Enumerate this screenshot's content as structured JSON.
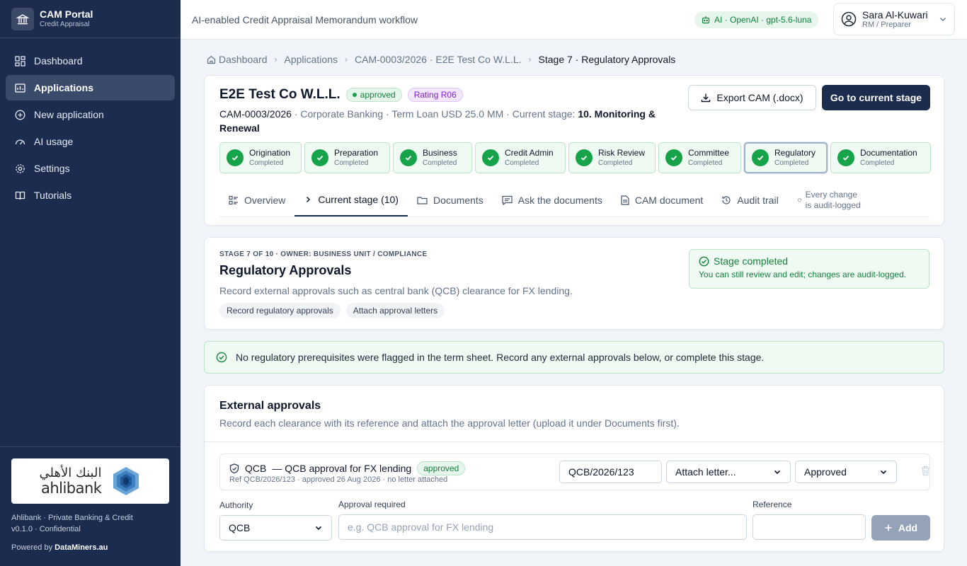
{
  "brand": {
    "title": "CAM Portal",
    "subtitle": "Credit Appraisal"
  },
  "sidebar": {
    "items": [
      {
        "label": "Dashboard",
        "icon": "dashboard-icon"
      },
      {
        "label": "Applications",
        "icon": "applications-icon",
        "active": true
      },
      {
        "label": "New application",
        "icon": "plus-circle-icon"
      },
      {
        "label": "AI usage",
        "icon": "gauge-icon"
      },
      {
        "label": "Settings",
        "icon": "gear-icon"
      },
      {
        "label": "Tutorials",
        "icon": "book-icon"
      }
    ],
    "bank_logo": {
      "arabic": "البنك الأهلي",
      "english": "ahlibank"
    },
    "footer_line1": "Ahlibank · Private Banking & Credit",
    "footer_line2": "v0.1.0 · Confidential",
    "powered_prefix": "Powered by",
    "powered_by": "DataMiners.au"
  },
  "header": {
    "title": "AI-enabled Credit Appraisal Memorandum workflow",
    "ai_badge": "AI · OpenAI · gpt-5.6-luna",
    "user": {
      "name": "Sara Al-Kuwari",
      "role": "RM / Preparer"
    }
  },
  "breadcrumb": [
    "Dashboard",
    "Applications",
    "CAM-0003/2026 · E2E Test Co W.L.L.",
    "Stage 7 · Regulatory Approvals"
  ],
  "application": {
    "name": "E2E Test Co W.L.L.",
    "status": "approved",
    "rating": "Rating R06",
    "id": "CAM-0003/2026",
    "meta": " · Corporate Banking · Term Loan USD 25.0 MM · Current stage: ",
    "current_stage": "10. Monitoring & Renewal",
    "export_label": "Export CAM (.docx)",
    "goto_label": "Go to current stage"
  },
  "stages": [
    {
      "name": "Origination",
      "status": "Completed"
    },
    {
      "name": "Preparation",
      "status": "Completed"
    },
    {
      "name": "Business",
      "status": "Completed"
    },
    {
      "name": "Credit Admin",
      "status": "Completed"
    },
    {
      "name": "Risk Review",
      "status": "Completed"
    },
    {
      "name": "Committee",
      "status": "Completed"
    },
    {
      "name": "Regulatory",
      "status": "Completed",
      "selected": true
    },
    {
      "name": "Documentation",
      "status": "Completed"
    }
  ],
  "tabs": [
    {
      "label": "Overview",
      "icon": "list-icon"
    },
    {
      "label": "Current stage (10)",
      "icon": "chevron-right-icon",
      "active": true
    },
    {
      "label": "Documents",
      "icon": "folder-icon"
    },
    {
      "label": "Ask the documents",
      "icon": "chat-icon"
    },
    {
      "label": "CAM document",
      "icon": "document-icon"
    },
    {
      "label": "Audit trail",
      "icon": "history-icon"
    }
  ],
  "audit_note": "Every change is audit-logged",
  "stage_card": {
    "eyebrow": "STAGE 7 OF 10 · OWNER: BUSINESS UNIT / COMPLIANCE",
    "title": "Regulatory Approvals",
    "description": "Record external approvals such as central bank (QCB) clearance for FX lending.",
    "chips": [
      "Record regulatory approvals",
      "Attach approval letters"
    ],
    "completed_title": "Stage completed",
    "completed_sub": "You can still review and edit; changes are audit-logged."
  },
  "alert": "No regulatory prerequisites were flagged in the term sheet. Record any external approvals below, or complete this stage.",
  "external": {
    "title": "External approvals",
    "subtitle": "Record each clearance with its reference and attach the approval letter (upload it under Documents first).",
    "row": {
      "authority": "QCB",
      "description": "— QCB approval for FX lending",
      "status": "approved",
      "meta": "Ref QCB/2026/123 · approved 26 Aug 2026 · no letter attached",
      "reference_value": "QCB/2026/123",
      "attach_value": "Attach letter...",
      "status_value": "Approved"
    },
    "form": {
      "authority_label": "Authority",
      "authority_value": "QCB",
      "approval_label": "Approval required",
      "approval_placeholder": "e.g. QCB approval for FX lending",
      "reference_label": "Reference",
      "reference_value": "",
      "add_label": "Add"
    }
  },
  "colors": {
    "navy": "#1b2c4f",
    "green": "#16a34a",
    "purple": "#7e22ce"
  }
}
